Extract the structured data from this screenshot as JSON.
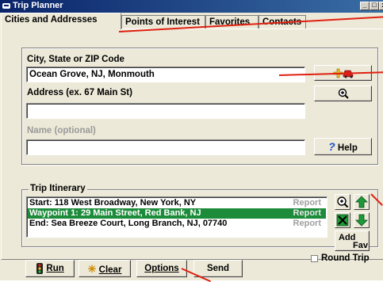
{
  "window": {
    "title": "Trip Planner",
    "controls": [
      "minimize",
      "maximize",
      "close"
    ]
  },
  "tabs": [
    {
      "label": "Cities and Addresses",
      "active": true
    },
    {
      "label": "Points of Interest",
      "active": false
    },
    {
      "label": "Favorites",
      "active": false
    },
    {
      "label": "Contacts",
      "active": false
    }
  ],
  "form": {
    "city_label": "City, State or ZIP Code",
    "city_value": "Ocean Grove, NJ, Monmouth",
    "address_label": "Address (ex. 67 Main St)",
    "address_value": "",
    "name_label": "Name (optional)",
    "name_value": "",
    "help_label": "Help"
  },
  "itinerary": {
    "title": "Trip Itinerary",
    "items": [
      {
        "text": "Start: 118 West Broadway, New York, NY",
        "report": "Report",
        "selected": false
      },
      {
        "text": "Waypoint 1: 29 Main Street, Red Bank, NJ",
        "report": "Report",
        "selected": true
      },
      {
        "text": "End: Sea Breeze Court, Long Branch, NJ, 07740",
        "report": "Report",
        "selected": false
      }
    ],
    "add_fav_label_1": "Add",
    "add_fav_label_2": "Fav",
    "round_trip_label": "Round Trip",
    "round_trip_checked": false
  },
  "bottom": {
    "run_label": "Run",
    "clear_label": "Clear",
    "options_label": "Options",
    "send_label": "Send"
  },
  "colors": {
    "titlebar": "#0a246a",
    "selection": "#1c8b3a",
    "annotation": "#e02010",
    "face": "#ece9d8"
  },
  "icons": [
    "car-icon",
    "zoom-icon",
    "help-question-icon",
    "up-arrow-icon",
    "down-arrow-icon",
    "remove-x-icon",
    "traffic-light-icon",
    "eraser-icon"
  ]
}
